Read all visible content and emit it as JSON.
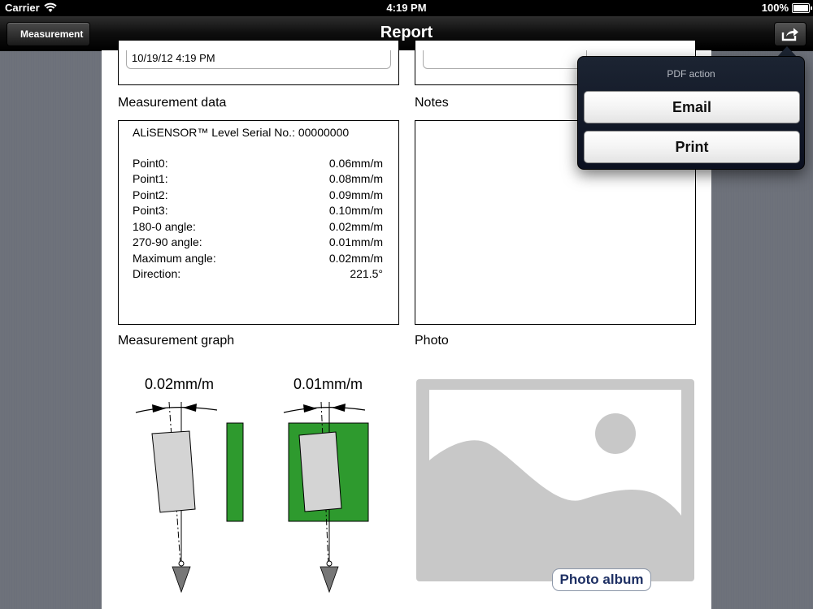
{
  "status_bar": {
    "carrier": "Carrier",
    "time": "4:19 PM",
    "battery": "100%"
  },
  "nav": {
    "back_label": "Measurement",
    "title": "Report"
  },
  "report": {
    "date": "10/19/12 4:19 PM",
    "measurement_data": {
      "heading": "Measurement data",
      "serial": "ALiSENSOR™ Level Serial No.: 00000000",
      "rows": [
        {
          "key": "Point0:",
          "value": "0.06mm/m"
        },
        {
          "key": "Point1:",
          "value": "0.08mm/m"
        },
        {
          "key": "Point2:",
          "value": "0.09mm/m"
        },
        {
          "key": "Point3:",
          "value": "0.10mm/m"
        },
        {
          "key": "180-0 angle:",
          "value": "0.02mm/m"
        },
        {
          "key": "270-90 angle:",
          "value": "0.01mm/m"
        },
        {
          "key": "Maximum angle:",
          "value": "0.02mm/m"
        },
        {
          "key": "Direction:",
          "value": "221.5°"
        }
      ]
    },
    "notes_heading": "Notes",
    "graph": {
      "heading": "Measurement graph",
      "left_value": "0.02mm/m",
      "right_value": "0.01mm/m"
    },
    "photo": {
      "heading": "Photo",
      "album_button": "Photo album"
    }
  },
  "popover": {
    "title": "PDF action",
    "email": "Email",
    "print": "Print"
  },
  "colors": {
    "green": "#2e9a2e",
    "gray_fill": "#d4d4d4",
    "photo_gray": "#c8c8c8"
  }
}
